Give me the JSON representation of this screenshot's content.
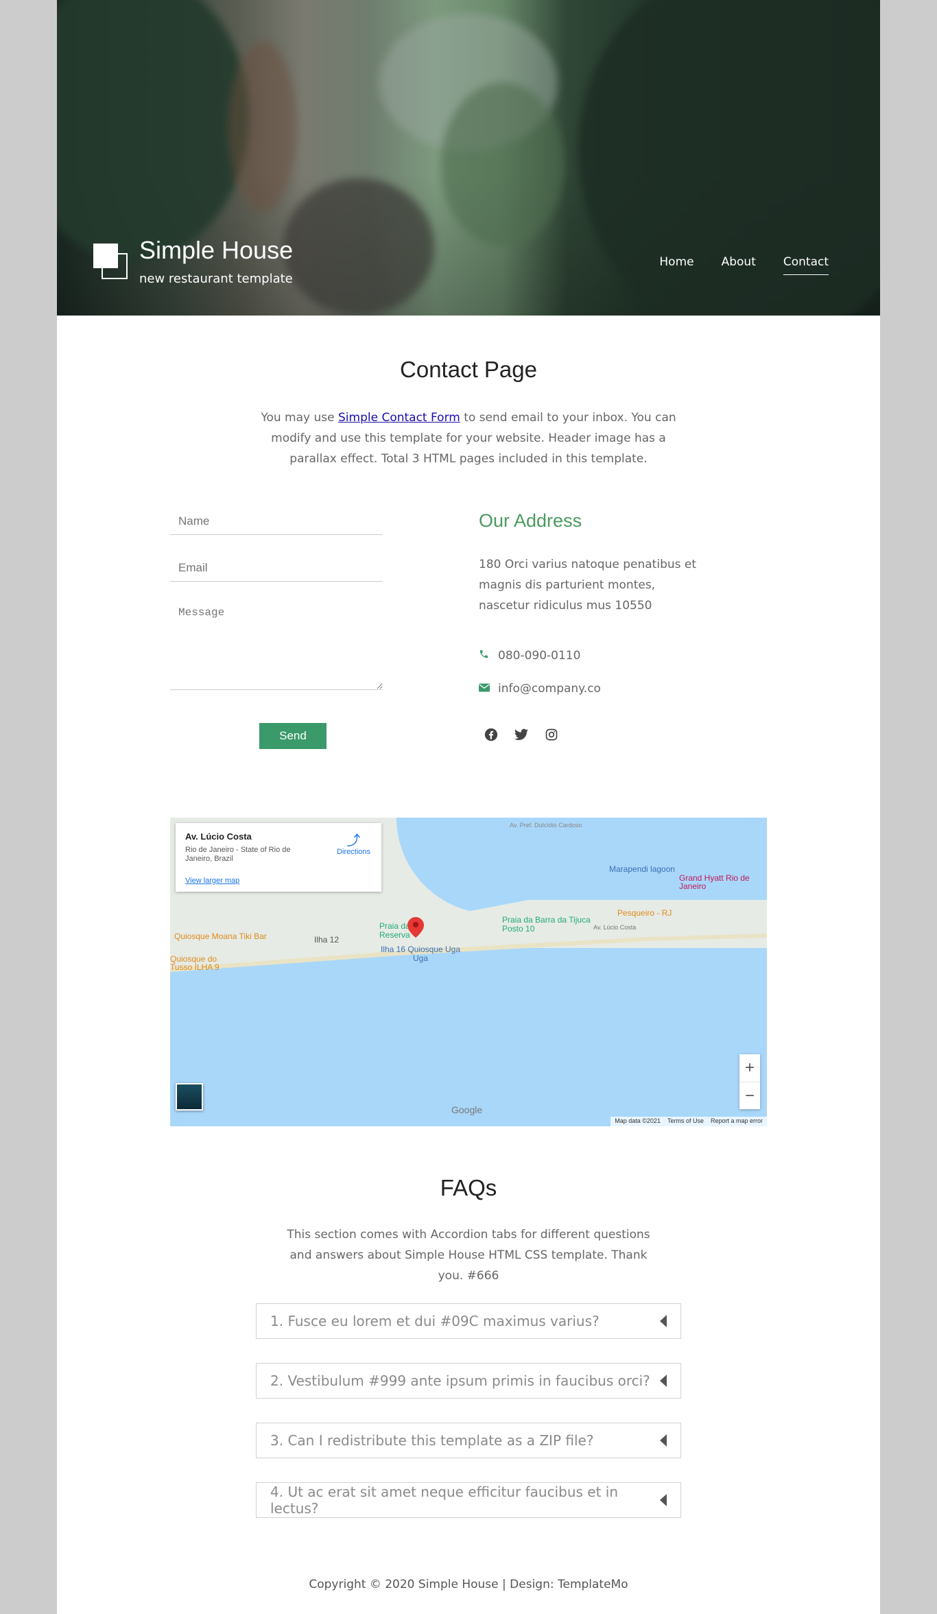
{
  "brand": {
    "title": "Simple House",
    "subtitle": "new restaurant template"
  },
  "nav": {
    "items": [
      "Home",
      "About",
      "Contact"
    ],
    "active": "Contact"
  },
  "contact": {
    "title": "Contact Page",
    "intro_before": "You may use ",
    "intro_link": "Simple Contact Form",
    "intro_after": " to send email to your inbox. You can modify and use this template for your website. Header image has a parallax effect. Total 3 HTML pages included in this template.",
    "form": {
      "name_placeholder": "Name",
      "email_placeholder": "Email",
      "message_placeholder": "Message",
      "send_label": "Send"
    },
    "address_title": "Our Address",
    "address_text": "180 Orci varius natoque penatibus et magnis dis parturient montes, nascetur ridiculus mus 10550",
    "phone": "080-090-0110",
    "email": "info@company.co",
    "social": [
      "facebook-icon",
      "twitter-icon",
      "instagram-icon"
    ]
  },
  "map": {
    "place_title": "Av. Lúcio Costa",
    "place_subtitle": "Rio de Janeiro - State of Rio de Janeiro, Brazil",
    "directions": "Directions",
    "larger_map": "View larger map",
    "labels": {
      "lagoon": "Marapendi lagoon",
      "grand_hyatt": "Grand Hyatt Rio de Janeiro",
      "pesqueiro": "Pesqueiro - RJ",
      "praia_barra": "Praia da Barra da Tijuca Posto 10",
      "av_lucio": "Av. Lúcio Costa",
      "praia_reserva": "Praia da Reserva",
      "ilha12": "Ilha 12",
      "ilha16": "Ilha 16 Quiosque Uga Uga",
      "moana": "Quiosque Moana Tiki Bar",
      "tusso": "Quiosque do Tusso ILHA 9",
      "dulcidio": "Av. Pref. Dulcídio Cardoso"
    },
    "zoom_in": "+",
    "zoom_out": "−",
    "google": "Google",
    "attribution": [
      "Map data ©2021",
      "Terms of Use",
      "Report a map error"
    ]
  },
  "faq": {
    "title": "FAQs",
    "intro": "This section comes with Accordion tabs for different questions and answers about Simple House HTML CSS template. Thank you. #666",
    "items": [
      "1. Fusce eu lorem et dui #09C maximus varius?",
      "2. Vestibulum #999 ante ipsum primis in faucibus orci?",
      "3. Can I redistribute this template as a ZIP file?",
      "4. Ut ac erat sit amet neque efficitur faucibus et in lectus?"
    ]
  },
  "footer": {
    "copyright": "Copyright © 2020 Simple House | Design: TemplateMo"
  },
  "colors": {
    "accent": "#3a9a6a",
    "address_title": "#4a9a5f",
    "page_bg": "#cccccc"
  }
}
